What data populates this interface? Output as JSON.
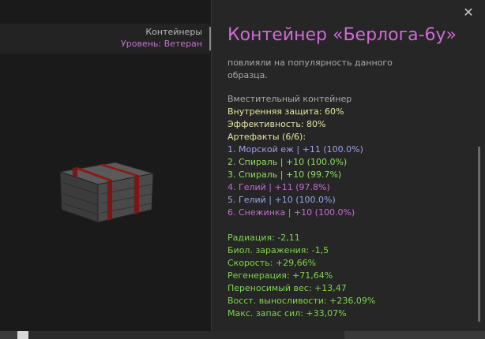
{
  "header": {
    "category": "Контейнеры",
    "level": "Уровень: Ветеран"
  },
  "item": {
    "title": "Контейнер «Берлога-6у»",
    "description_lines": [
      "повлияли на популярность данного",
      "образца."
    ],
    "type": "Вместительный контейнер",
    "internal_protection": "Внутренняя защита: 60%",
    "efficiency": "Эффективность: 80%",
    "artifacts_header": "Артефакты (6/6):",
    "artifacts": [
      {
        "text": "1. Морской еж | +11 (100.0%)",
        "color": "#9fa0ee"
      },
      {
        "text": "2. Спираль | +10 (100.0%)",
        "color": "#8ce05a"
      },
      {
        "text": "3. Спираль | +10 (99.7%)",
        "color": "#8ce05a"
      },
      {
        "text": "4. Гелий | +11 (97.8%)",
        "color": "#c46ad4"
      },
      {
        "text": "5. Гелий | +10 (100.0%)",
        "color": "#9fa0ee"
      },
      {
        "text": "6. Снежинка | +10 (100.0%)",
        "color": "#c46ad4"
      }
    ],
    "stats": [
      "Радиация: -2,11",
      "Биол. заражения: -1,5",
      "Скорость: +29,66%",
      "Регенерация: +71,64%",
      "Переносимый вес: +13,47",
      "Восст. выносливости: +236,09%",
      "Макс. запас сил: +33,07%"
    ]
  },
  "icons": {
    "close": "close-icon"
  },
  "colors": {
    "title": "#cf6bd6",
    "level": "#c470d4",
    "stat_green": "#7ed64a",
    "highlight_yellow": "#e6e6a0"
  }
}
